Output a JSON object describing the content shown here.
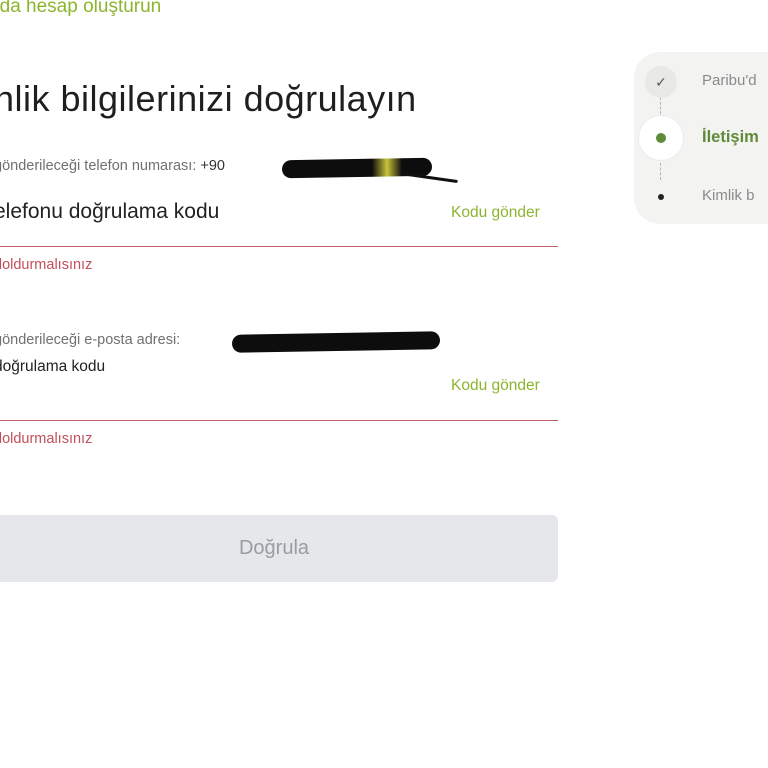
{
  "header": {
    "top_link": "'da hesap oluşturun",
    "title": "nlik bilgilerinizi doğrulayın"
  },
  "phone": {
    "hint": "gönderileceği telefon numarası:",
    "number_prefix": "+90",
    "label": "elefonu doğrulama kodu",
    "send_code": "Kodu gönder",
    "error": "doldurmalısınız"
  },
  "email": {
    "hint": "gönderileceği e-posta adresi:",
    "label": "doğrulama kodu",
    "send_code": "Kodu gönder",
    "error": "doldurmalısınız"
  },
  "verify_button": {
    "label": "Doğrula"
  },
  "stepper": {
    "steps": [
      {
        "label": "Paribu'd",
        "state": "completed",
        "icon": "check-icon"
      },
      {
        "label": "İletişim",
        "state": "active",
        "icon": "dot-icon"
      },
      {
        "label": "Kimlik b",
        "state": "pending",
        "icon": "dot-icon"
      }
    ]
  },
  "colors": {
    "accent": "#8cb52f",
    "active_step": "#5e8a3a",
    "error": "#c0505a",
    "disabled_button_bg": "#e6e7ea",
    "disabled_button_text": "#9a9ca2"
  }
}
